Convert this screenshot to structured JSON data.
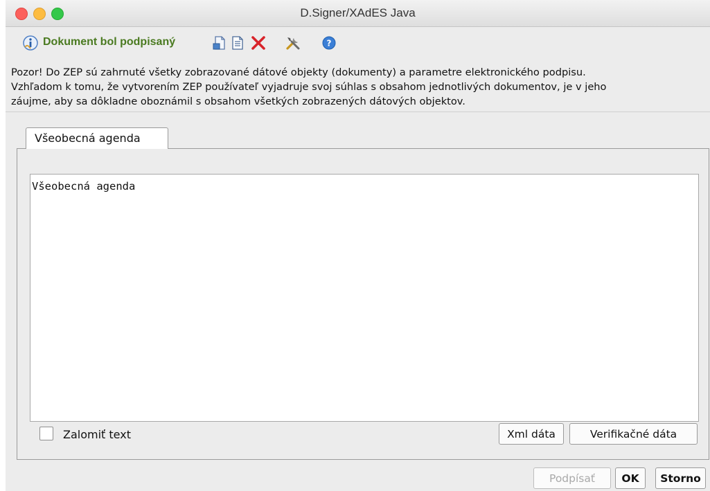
{
  "window": {
    "title": "D.Signer/XAdES Java"
  },
  "toolbar": {
    "status": "Dokument bol podpisaný",
    "icons": [
      "info-icon",
      "document-export-icon",
      "document-text-icon",
      "delete-icon",
      "settings-tools-icon",
      "help-icon"
    ]
  },
  "notice": {
    "line1": "Pozor! Do ZEP sú zahrnuté všetky zobrazované dátové objekty (dokumenty) a parametre elektronického podpisu.",
    "line2": "Vzhľadom k tomu, že vytvorením ZEP používateľ vyjadruje svoj súhlas s obsahom jednotlivých dokumentov, je v jeho",
    "line3": "záujme, aby sa dôkladne oboznámil s obsahom všetkých zobrazených dátových objektov."
  },
  "tabs": [
    {
      "label": "Všeobecná agenda",
      "active": true
    }
  ],
  "content": {
    "text": "Všeobecná agenda"
  },
  "options": {
    "wrap_label": "Zalomiť text",
    "wrap_checked": false
  },
  "buttons": {
    "xml": "Xml dáta",
    "verification": "Verifikačné dáta",
    "sign": "Podpísať",
    "ok": "OK",
    "cancel": "Storno"
  },
  "colors": {
    "status_text": "#4a7a20",
    "close": "#fc605c",
    "minimize": "#fdbc40",
    "maximize": "#34c84a",
    "delete": "#d8232a",
    "help": "#3b7fd6"
  }
}
